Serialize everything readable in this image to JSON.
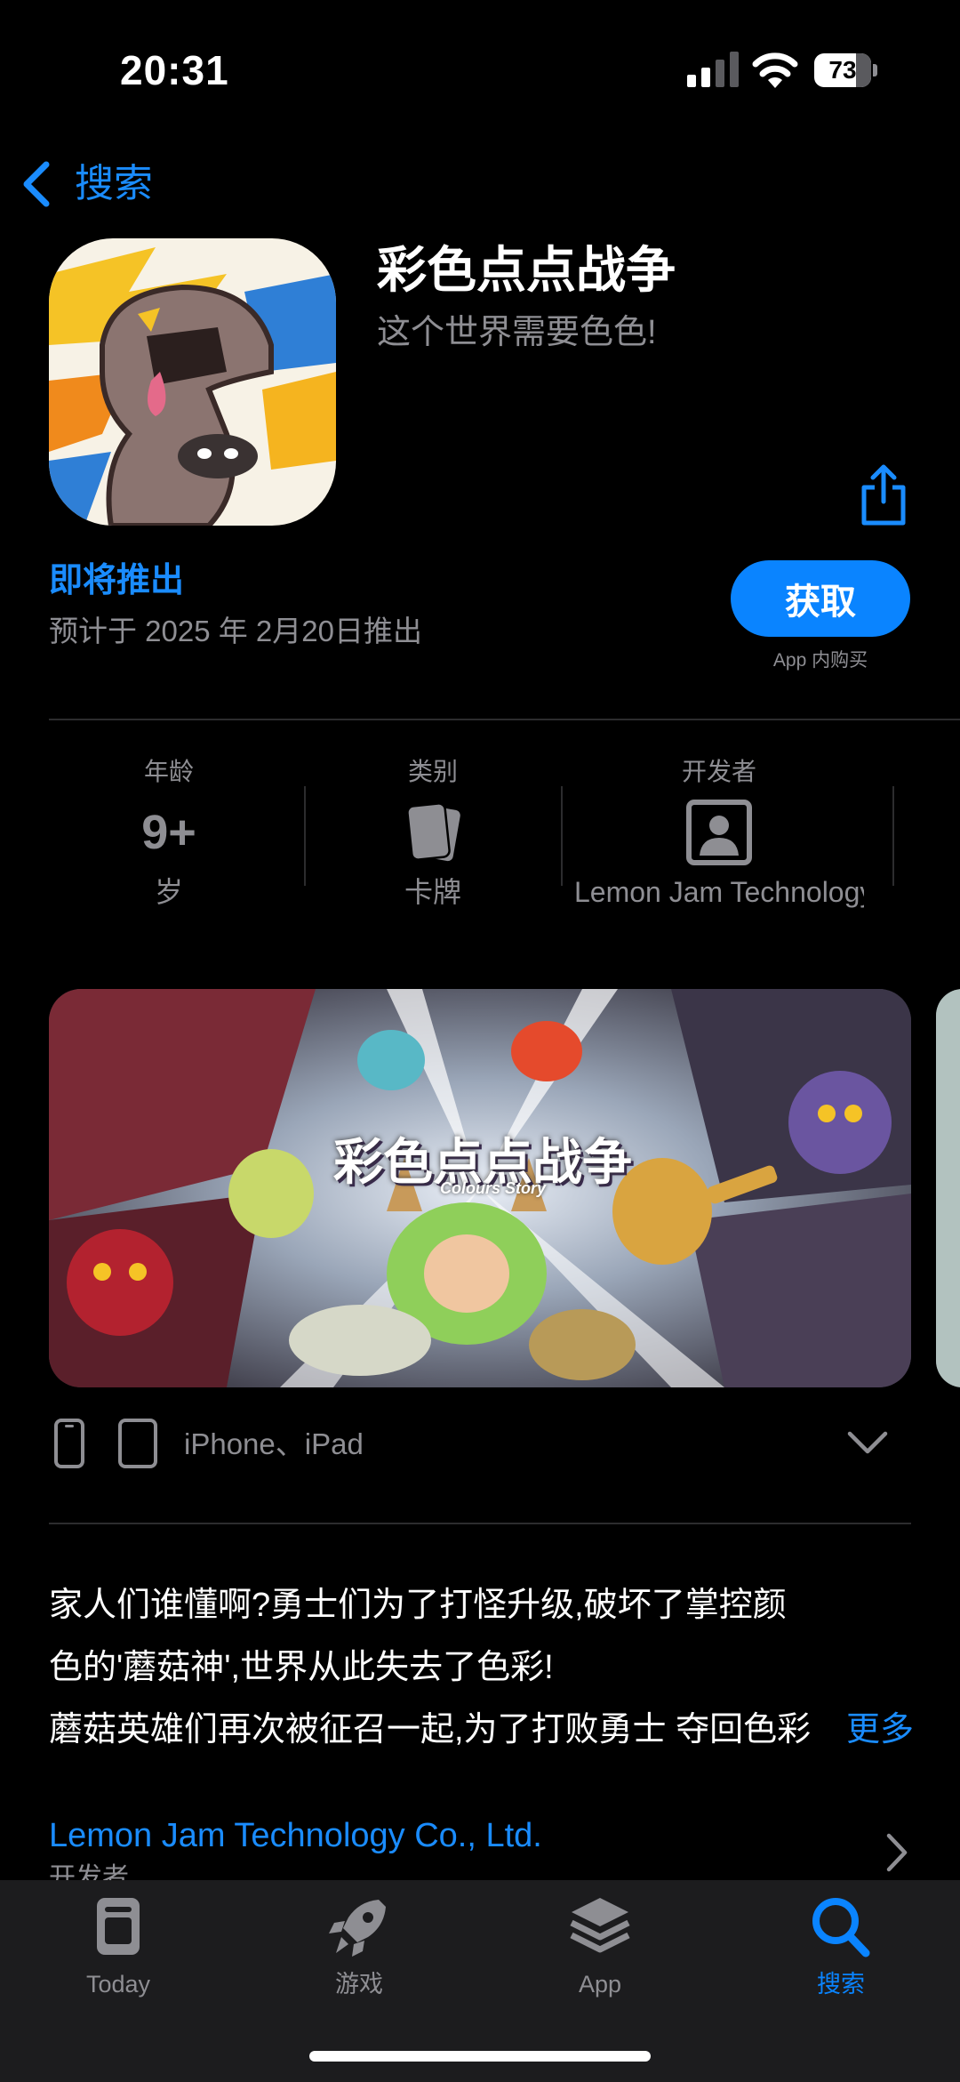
{
  "status_bar": {
    "time": "20:31",
    "battery": "73"
  },
  "nav": {
    "back_label": "搜索"
  },
  "app": {
    "title": "彩色点点战争",
    "subtitle": "这个世界需要色色!",
    "coming_soon": "即将推出",
    "release_date": "预计于 2025 年 2月20日推出",
    "get_button": "获取",
    "iap_note": "App 内购买"
  },
  "info": {
    "age": {
      "header": "年龄",
      "value": "9+",
      "footer": "岁"
    },
    "category": {
      "header": "类别",
      "icon": "cards-icon",
      "footer": "卡牌"
    },
    "developer": {
      "header": "开发者",
      "icon": "person-icon",
      "footer": "Lemon Jam Technology Co., Ltd."
    }
  },
  "screenshot": {
    "logo_text": "彩色点点战争",
    "logo_sub": "Colours Story"
  },
  "devices": {
    "label": "iPhone、iPad"
  },
  "description": {
    "line1": "家人们谁懂啊?勇士们为了打怪升级,破坏了掌控颜",
    "line2": "色的'蘑菇神',世界从此失去了色彩!",
    "line3": "蘑菇英雄们再次被征召一起,为了打败勇士 夺回色彩",
    "more": "更多"
  },
  "developer_link": {
    "name": "Lemon Jam Technology Co., Ltd.",
    "sub": "开发者"
  },
  "tabs": [
    {
      "label": "Today",
      "icon": "today-icon"
    },
    {
      "label": "游戏",
      "icon": "rocket-icon"
    },
    {
      "label": "App",
      "icon": "layers-icon"
    },
    {
      "label": "搜索",
      "icon": "search-icon"
    }
  ],
  "colors": {
    "accent": "#0a84ff",
    "link": "#1a8cff",
    "secondary_text": "#8e8e93",
    "tabbar_bg": "#1c1c1e"
  }
}
